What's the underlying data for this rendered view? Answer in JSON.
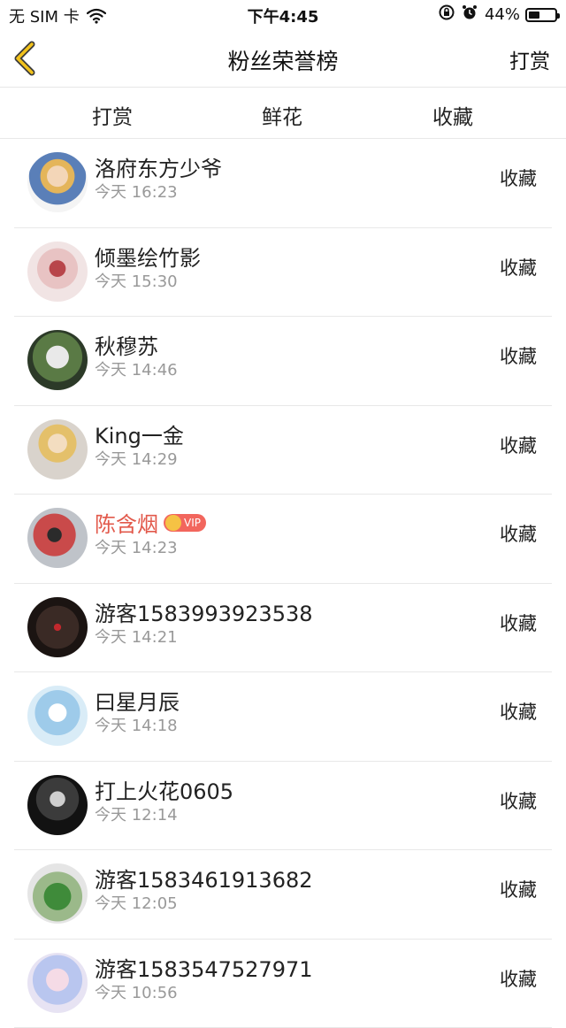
{
  "status_bar": {
    "carrier": "无 SIM 卡",
    "time": "下午4:45",
    "battery": "44%",
    "battery_level": 0.44
  },
  "nav": {
    "title": "粉丝荣誉榜",
    "action": "打赏"
  },
  "tabs": [
    {
      "label": "打赏",
      "active": false
    },
    {
      "label": "鲜花",
      "active": false
    },
    {
      "label": "收藏",
      "active": true
    }
  ],
  "colors": {
    "accent": "#e2a22b",
    "vip_name": "#e2594b",
    "vip_badge": "#f2665d"
  },
  "fans": [
    {
      "name": "洛府东方少爷",
      "time": "今天 16:23",
      "action": "收藏",
      "vip": false,
      "vip_label": ""
    },
    {
      "name": "倾墨绘竹影",
      "time": "今天 15:30",
      "action": "收藏",
      "vip": false,
      "vip_label": ""
    },
    {
      "name": "秋穆苏",
      "time": "今天 14:46",
      "action": "收藏",
      "vip": false,
      "vip_label": ""
    },
    {
      "name": "King一金",
      "time": "今天 14:29",
      "action": "收藏",
      "vip": false,
      "vip_label": ""
    },
    {
      "name": "陈含烟",
      "time": "今天 14:23",
      "action": "收藏",
      "vip": true,
      "vip_label": "VIP"
    },
    {
      "name": "游客1583993923538",
      "time": "今天 14:21",
      "action": "收藏",
      "vip": false,
      "vip_label": ""
    },
    {
      "name": "曰星月辰",
      "time": "今天 14:18",
      "action": "收藏",
      "vip": false,
      "vip_label": ""
    },
    {
      "name": "打上火花0605",
      "time": "今天 12:14",
      "action": "收藏",
      "vip": false,
      "vip_label": ""
    },
    {
      "name": "游客1583461913682",
      "time": "今天 12:05",
      "action": "收藏",
      "vip": false,
      "vip_label": ""
    },
    {
      "name": "游客1583547527971",
      "time": "今天 10:56",
      "action": "收藏",
      "vip": false,
      "vip_label": ""
    }
  ]
}
